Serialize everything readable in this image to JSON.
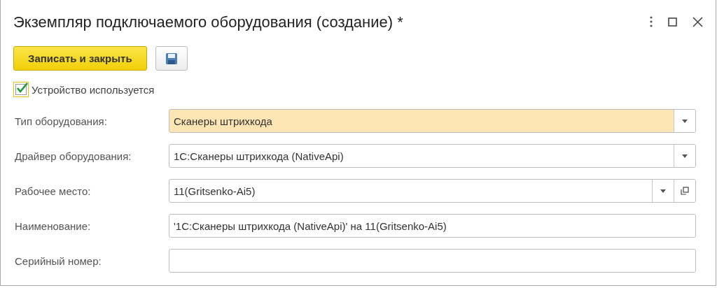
{
  "window": {
    "title": "Экземпляр подключаемого оборудования (создание) *"
  },
  "toolbar": {
    "primary_button": "Записать и закрыть"
  },
  "device_in_use": {
    "label": "Устройство используется",
    "checked": true
  },
  "fields": [
    {
      "label": "Тип оборудования:",
      "value": "Сканеры штрихкода",
      "highlighted": true,
      "dropdown": true,
      "open_button": false
    },
    {
      "label": "Драйвер оборудования:",
      "value": "1С:Сканеры штрихкода (NativeApi)",
      "highlighted": false,
      "dropdown": true,
      "open_button": false
    },
    {
      "label": "Рабочее место:",
      "value": "11(Gritsenko-Ai5)",
      "highlighted": false,
      "dropdown": true,
      "open_button": true
    },
    {
      "label": "Наименование:",
      "value": "'1С:Сканеры штрихкода (NativeApi)' на 11(Gritsenko-Ai5)",
      "highlighted": false,
      "dropdown": false,
      "open_button": false
    },
    {
      "label": "Серийный номер:",
      "highlighted": false,
      "dropdown": false,
      "open_button": false
    }
  ]
}
